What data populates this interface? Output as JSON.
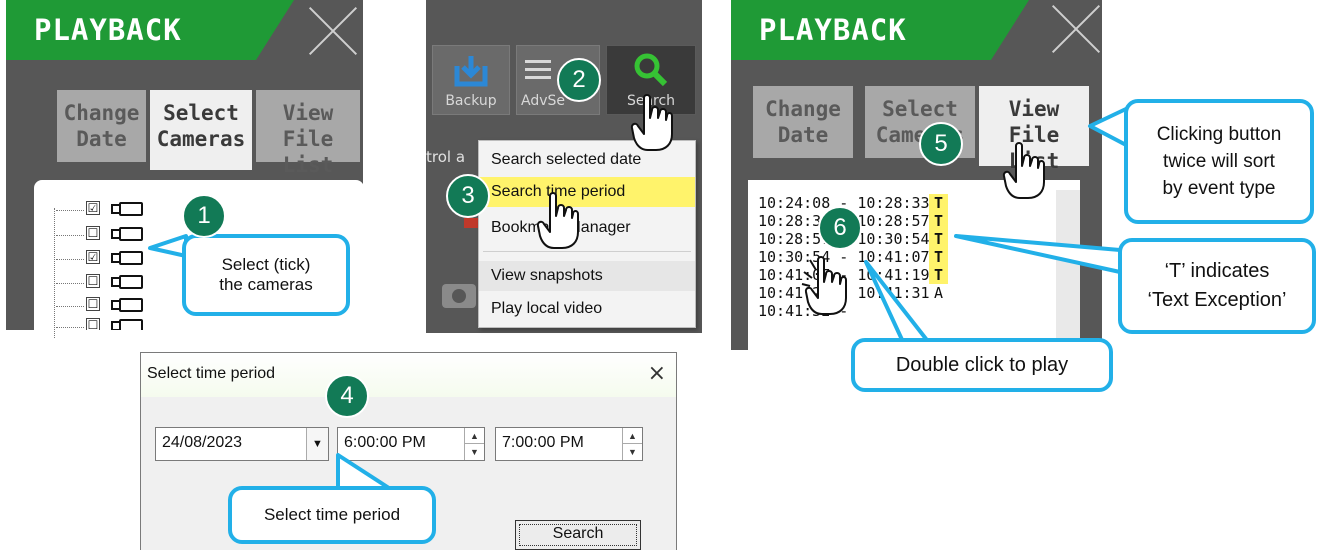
{
  "panel1": {
    "header": "PLAYBACK",
    "tabs": [
      {
        "label": "Change\nDate"
      },
      {
        "label": "Select\nCameras"
      },
      {
        "label": "View\nFile List"
      }
    ],
    "cameras": [
      {
        "checked": "☑"
      },
      {
        "checked": "☐"
      },
      {
        "checked": "☑"
      },
      {
        "checked": "☐"
      },
      {
        "checked": "☐"
      },
      {
        "checked": "☐"
      }
    ]
  },
  "panel2": {
    "toolbar": {
      "backup_label": "Backup",
      "advsearch_label": "AdvSe",
      "search_label": "Search"
    },
    "side_text": "trol a",
    "menu": {
      "items": [
        {
          "label": "Search selected date"
        },
        {
          "label": "Search time period"
        },
        {
          "label": "Bookmark Manager"
        },
        {
          "label": "View snapshots"
        },
        {
          "label": "Play local video"
        }
      ]
    }
  },
  "panel3": {
    "header": "PLAYBACK",
    "tabs": [
      {
        "label": "Change\nDate"
      },
      {
        "label": "Select\nCameras"
      },
      {
        "label": "View\nFile List"
      }
    ],
    "files": [
      {
        "range": "10:24:08 - 10:28:33",
        "type": "T"
      },
      {
        "range": "10:28:33 - 10:28:57",
        "type": "T"
      },
      {
        "range": "10:28:57 - 10:30:54",
        "type": "T"
      },
      {
        "range": "10:30:54 - 10:41:07",
        "type": "T"
      },
      {
        "range": "10:41:07 - 10:41:19",
        "type": "T"
      },
      {
        "range": "10:41:20 - 10:41:31",
        "type": "A"
      },
      {
        "range": "10:41:32 -",
        "type": ""
      }
    ]
  },
  "dialog": {
    "title": "Select time period",
    "close": "×",
    "date_value": "24/08/2023",
    "start_time": "6:00:00 PM",
    "end_time": "7:00:00 PM",
    "search_button": "Search"
  },
  "annotations": {
    "badges": [
      "1",
      "2",
      "3",
      "4",
      "5",
      "6"
    ],
    "callout_cameras": "Select (tick)\nthe cameras",
    "callout_sort": "Clicking button\ntwice will sort\nby event type",
    "callout_type": "‘T’ indicates\n‘Text Exception’",
    "callout_play": "Double click to play",
    "callout_period": "Select time period"
  },
  "colors": {
    "header_green": "#1f9a36",
    "badge_green": "#127a56",
    "callout_blue": "#22b0e8",
    "highlight_yellow": "#fff36b"
  }
}
